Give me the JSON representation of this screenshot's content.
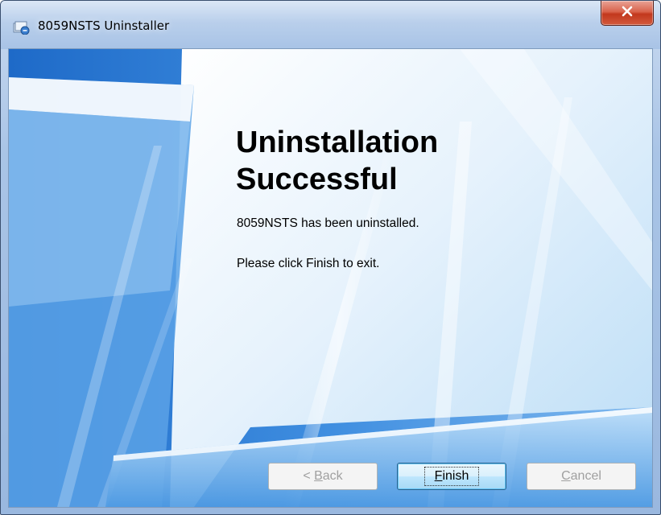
{
  "window": {
    "title": "8059NSTS Uninstaller",
    "close_symbol": "x"
  },
  "content": {
    "heading_line1": "Uninstallation",
    "heading_line2": "Successful",
    "message": "8059NSTS has been uninstalled.",
    "instruction": "Please click Finish to exit."
  },
  "buttons": {
    "back": {
      "prefix": "< ",
      "mnemonic": "B",
      "rest": "ack",
      "enabled": false
    },
    "finish": {
      "prefix": "",
      "mnemonic": "F",
      "rest": "inish",
      "enabled": true
    },
    "cancel": {
      "prefix": "",
      "mnemonic": "C",
      "rest": "ancel",
      "enabled": false
    }
  },
  "icons": {
    "title_icon": "uninstaller-app-icon",
    "close_icon": "close-icon"
  },
  "colors": {
    "close_button": "#c7402a",
    "background_blue": "#4a90dc",
    "focus_button": "#bee6fd"
  }
}
